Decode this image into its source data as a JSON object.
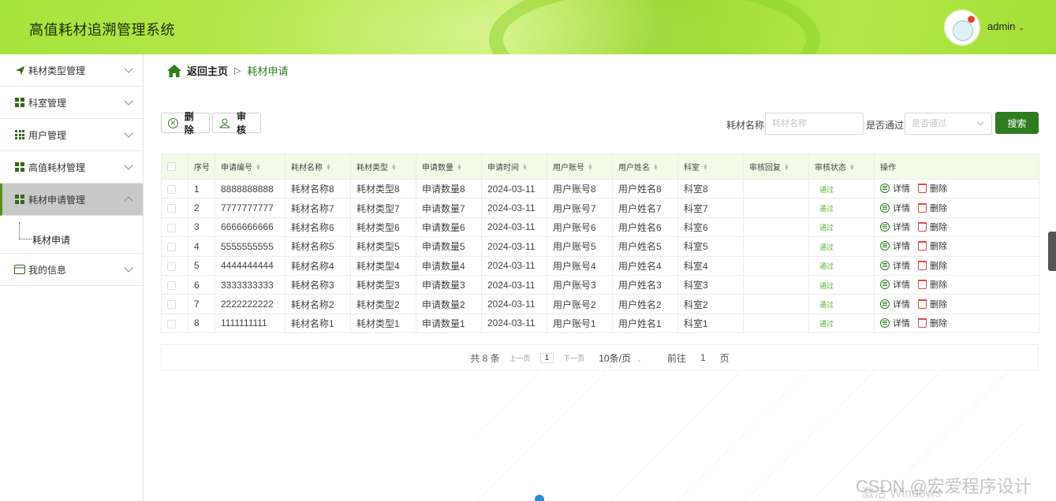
{
  "header": {
    "title": "高值耗材追溯管理系统",
    "user": "admin"
  },
  "sidebar": {
    "items": [
      {
        "label": "耗材类型管理"
      },
      {
        "label": "科室管理"
      },
      {
        "label": "用户管理"
      },
      {
        "label": "高值耗材管理"
      },
      {
        "label": "耗材申请管理"
      },
      {
        "label": "我的信息"
      }
    ],
    "sub_label": "耗材申请"
  },
  "breadcrumb": {
    "home": "返回主页",
    "sep": "▷",
    "current": "耗材申请"
  },
  "toolbar": {
    "delete_label": "删除",
    "audit_label": "审核"
  },
  "search": {
    "name_label": "耗材名称",
    "name_placeholder": "耗材名称",
    "pass_label": "是否通过",
    "pass_placeholder": "是否通过",
    "button": "搜索"
  },
  "table": {
    "headers": [
      "序号",
      "申请编号",
      "耗材名称",
      "耗材类型",
      "申请数量",
      "申请时间",
      "用户账号",
      "用户姓名",
      "科室",
      "审核回复",
      "审核状态",
      "操作"
    ],
    "rows": [
      [
        "1",
        "8888888888",
        "耗材名称8",
        "耗材类型8",
        "申请数量8",
        "2024-03-11",
        "用户账号8",
        "用户姓名8",
        "科室8",
        "",
        "通过"
      ],
      [
        "2",
        "7777777777",
        "耗材名称7",
        "耗材类型7",
        "申请数量7",
        "2024-03-11",
        "用户账号7",
        "用户姓名7",
        "科室7",
        "",
        "通过"
      ],
      [
        "3",
        "6666666666",
        "耗材名称6",
        "耗材类型6",
        "申请数量6",
        "2024-03-11",
        "用户账号6",
        "用户姓名6",
        "科室6",
        "",
        "通过"
      ],
      [
        "4",
        "5555555555",
        "耗材名称5",
        "耗材类型5",
        "申请数量5",
        "2024-03-11",
        "用户账号5",
        "用户姓名5",
        "科室5",
        "",
        "通过"
      ],
      [
        "5",
        "4444444444",
        "耗材名称4",
        "耗材类型4",
        "申请数量4",
        "2024-03-11",
        "用户账号4",
        "用户姓名4",
        "科室4",
        "",
        "通过"
      ],
      [
        "6",
        "3333333333",
        "耗材名称3",
        "耗材类型3",
        "申请数量3",
        "2024-03-11",
        "用户账号3",
        "用户姓名3",
        "科室3",
        "",
        "通过"
      ],
      [
        "7",
        "2222222222",
        "耗材名称2",
        "耗材类型2",
        "申请数量2",
        "2024-03-11",
        "用户账号2",
        "用户姓名2",
        "科室2",
        "",
        "通过"
      ],
      [
        "8",
        "1111111111",
        "耗材名称1",
        "耗材类型1",
        "申请数量1",
        "2024-03-11",
        "用户账号1",
        "用户姓名1",
        "科室1",
        "",
        "通过"
      ]
    ],
    "detail_label": "详情",
    "delete_label": "删除"
  },
  "pager": {
    "total": "共 8 条",
    "prev": "上一页",
    "page": "1",
    "next": "下一页",
    "size": "10条/页",
    "goto": "前往",
    "goto_page": "1",
    "page_unit": "页"
  },
  "watermark": {
    "text": "CSDN @宏爱程序设计",
    "sub": "激活 Windows"
  },
  "colors": {
    "primary": "#2e7d1f",
    "header": "#a6e23c",
    "status": "#58b42f",
    "danger": "#e0493d"
  }
}
